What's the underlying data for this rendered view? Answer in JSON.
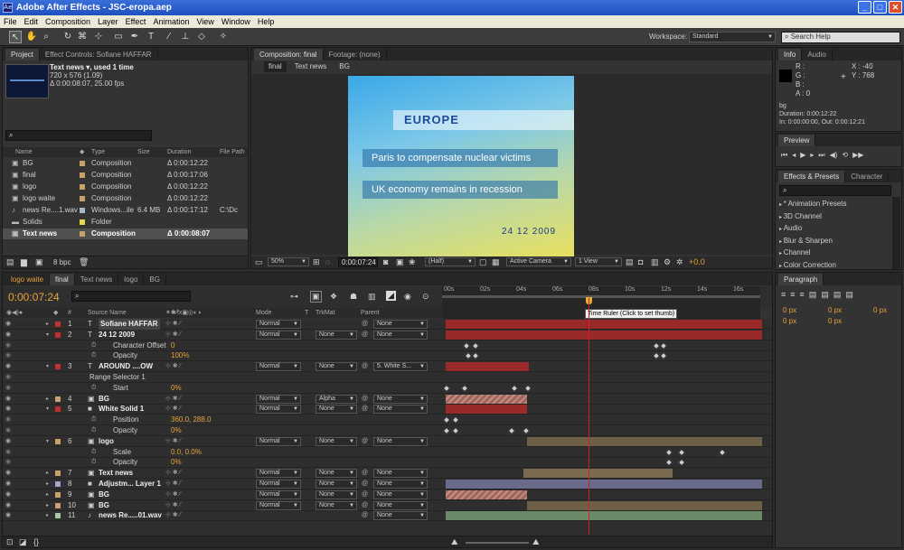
{
  "window": {
    "title": "Adobe After Effects - JSC-eropa.aep",
    "icon": "Ae",
    "buttons": [
      "_",
      "□",
      "✕"
    ]
  },
  "menu": [
    "File",
    "Edit",
    "Composition",
    "Layer",
    "Effect",
    "Animation",
    "View",
    "Window",
    "Help"
  ],
  "toolbar": {
    "workspace_label": "Workspace:",
    "workspace_value": "Standard",
    "search_placeholder": "Search Help"
  },
  "project": {
    "tabs": [
      "Project",
      "Effect Controls: Sofiane HAFFAR"
    ],
    "selected_name": "Text news ▾, used 1 time",
    "selected_size": "720 x 576 (1.09)",
    "selected_duration": "Δ 0:00:08:07, 25.00 fps",
    "columns": [
      "Name",
      "Type",
      "Size",
      "Duration",
      "File Path"
    ],
    "items": [
      {
        "name": "BG",
        "type": "Composition",
        "size": "",
        "duration": "Δ 0:00:12:22",
        "path": "",
        "color": "#c7a36a",
        "icon": "comp-icon"
      },
      {
        "name": "final",
        "type": "Composition",
        "size": "",
        "duration": "Δ 0:00:17:06",
        "path": "",
        "color": "#c7a36a",
        "icon": "comp-icon"
      },
      {
        "name": "logo",
        "type": "Composition",
        "size": "",
        "duration": "Δ 0:00:12:22",
        "path": "",
        "color": "#c7a36a",
        "icon": "comp-icon"
      },
      {
        "name": "logo waite",
        "type": "Composition",
        "size": "",
        "duration": "Δ 0:00:12:22",
        "path": "",
        "color": "#c7a36a",
        "icon": "comp-icon"
      },
      {
        "name": "news Re....1.wav",
        "type": "Windows...ile",
        "size": "6.4 MB",
        "duration": "Δ 0:00:17:12",
        "path": "C:\\Dc",
        "color": "#a5b8c8",
        "icon": "audio-icon"
      },
      {
        "name": "Solids",
        "type": "Folder",
        "size": "",
        "duration": "",
        "path": "",
        "color": "#e6d84a",
        "icon": "folder-icon"
      },
      {
        "name": "Text news",
        "type": "Composition",
        "size": "",
        "duration": "Δ 0:00:08:07",
        "path": "",
        "color": "#c7a36a",
        "icon": "comp-icon"
      }
    ],
    "bpc": "8 bpc"
  },
  "comp": {
    "tabs": [
      "Composition: final",
      "Footage: (none)"
    ],
    "breadcrumbs": [
      "final",
      "Text news",
      "BG"
    ],
    "europe": "EUROPE",
    "line1": "Paris to compensate nuclear victims",
    "line2": "UK economy remains in recession",
    "date": "24 12 2009",
    "zoom": "50%",
    "timecode": "0:00:07:24",
    "quality": "(Half)",
    "camera": "Active Camera",
    "view": "1 View",
    "exposure": "+0.0"
  },
  "info": {
    "tabs": [
      "Info",
      "Audio"
    ],
    "r": "R :",
    "g": "G :",
    "b": "B :",
    "a": "A : 0",
    "x": "X : -40",
    "y": "Y : 768",
    "layer": "bg",
    "duration": "Duration: 0:00:12:22",
    "inout": "In: 0:00:00:00, Out: 0:00:12:21"
  },
  "preview": {
    "title": "Preview"
  },
  "effects": {
    "tabs": [
      "Effects & Presets",
      "Character"
    ],
    "search_placeholder": "",
    "items": [
      "* Animation Presets",
      "3D Channel",
      "Audio",
      "Blur & Sharpen",
      "Channel",
      "Color Correction"
    ]
  },
  "paragraph": {
    "title": "Paragraph",
    "v1": "0 px",
    "v2": "0 px",
    "v3": "0 px",
    "v4": "0 px",
    "v5": "0 px"
  },
  "timeline": {
    "tabs": [
      "logo waite",
      "final",
      "Text news",
      "logo",
      "BG"
    ],
    "timecode": "0:00:07:24",
    "headers": {
      "num": "#",
      "source": "Source Name",
      "mode": "Mode",
      "t": "T",
      "trkmat": "TrkMat",
      "parent": "Parent"
    },
    "ruler_ticks": [
      "00s",
      "02s",
      "04s",
      "06s",
      "08s",
      "10s",
      "12s",
      "14s",
      "16s"
    ],
    "tooltip": "Time Ruler (Click to set thumb)",
    "layers": [
      {
        "num": "1",
        "name": "Sofiane HAFFAR",
        "mode": "Normal",
        "trkmat": "",
        "parent": "None",
        "color": "#c03030",
        "bold": true,
        "type": "text",
        "props": []
      },
      {
        "num": "2",
        "name": "24 12 2009",
        "mode": "Normal",
        "trkmat": "None",
        "parent": "None",
        "color": "#c03030",
        "bold": true,
        "type": "text",
        "props": [
          {
            "name": "Character Offset",
            "value": "0"
          },
          {
            "name": "Opacity",
            "value": "100%"
          }
        ]
      },
      {
        "num": "3",
        "name": "AROUND ....OW",
        "mode": "Normal",
        "trkmat": "None",
        "parent": "5. White S...",
        "color": "#c03030",
        "bold": true,
        "type": "text",
        "props": [
          {
            "name": "Range Selector 1",
            "value": ""
          },
          {
            "name": "Start",
            "value": "0%"
          }
        ]
      },
      {
        "num": "4",
        "name": "BG",
        "mode": "Normal",
        "trkmat": "Alpha",
        "parent": "None",
        "color": "#c7a36a",
        "bold": true,
        "type": "comp",
        "props": []
      },
      {
        "num": "5",
        "name": "White Solid 1",
        "mode": "Normal",
        "trkmat": "None",
        "parent": "None",
        "color": "#c03030",
        "bold": true,
        "type": "solid",
        "props": [
          {
            "name": "Position",
            "value": "360.0, 288.0"
          },
          {
            "name": "Opacity",
            "value": "0%"
          }
        ]
      },
      {
        "num": "6",
        "name": "logo",
        "mode": "Normal",
        "trkmat": "None",
        "parent": "None",
        "color": "#c7a36a",
        "bold": true,
        "type": "comp",
        "props": [
          {
            "name": "Scale",
            "value": "0.0, 0.0%"
          },
          {
            "name": "Opacity",
            "value": "0%"
          }
        ]
      },
      {
        "num": "7",
        "name": "Text news",
        "mode": "Normal",
        "trkmat": "None",
        "parent": "None",
        "color": "#c7a36a",
        "bold": true,
        "type": "comp",
        "props": []
      },
      {
        "num": "8",
        "name": "Adjustm... Layer 1",
        "mode": "Normal",
        "trkmat": "None",
        "parent": "None",
        "color": "#a5a5c8",
        "bold": true,
        "type": "solid",
        "props": []
      },
      {
        "num": "9",
        "name": "BG",
        "mode": "Normal",
        "trkmat": "None",
        "parent": "None",
        "color": "#c7a36a",
        "bold": true,
        "type": "comp",
        "props": []
      },
      {
        "num": "10",
        "name": "BG",
        "mode": "Normal",
        "trkmat": "None",
        "parent": "None",
        "color": "#c7a36a",
        "bold": true,
        "type": "comp",
        "props": []
      },
      {
        "num": "11",
        "name": "news Re.....01.wav",
        "mode": "",
        "trkmat": "",
        "parent": "None",
        "color": "#a5c8a5",
        "bold": true,
        "type": "audio",
        "props": []
      }
    ]
  },
  "colors": {
    "accent_orange": "#e8a23a",
    "playhead": "#d42020",
    "bar_red": "#9a2a2a",
    "bar_tan": "#7a6a50",
    "bar_purple": "#6a6a8a",
    "bar_green": "#6a8a6a"
  }
}
